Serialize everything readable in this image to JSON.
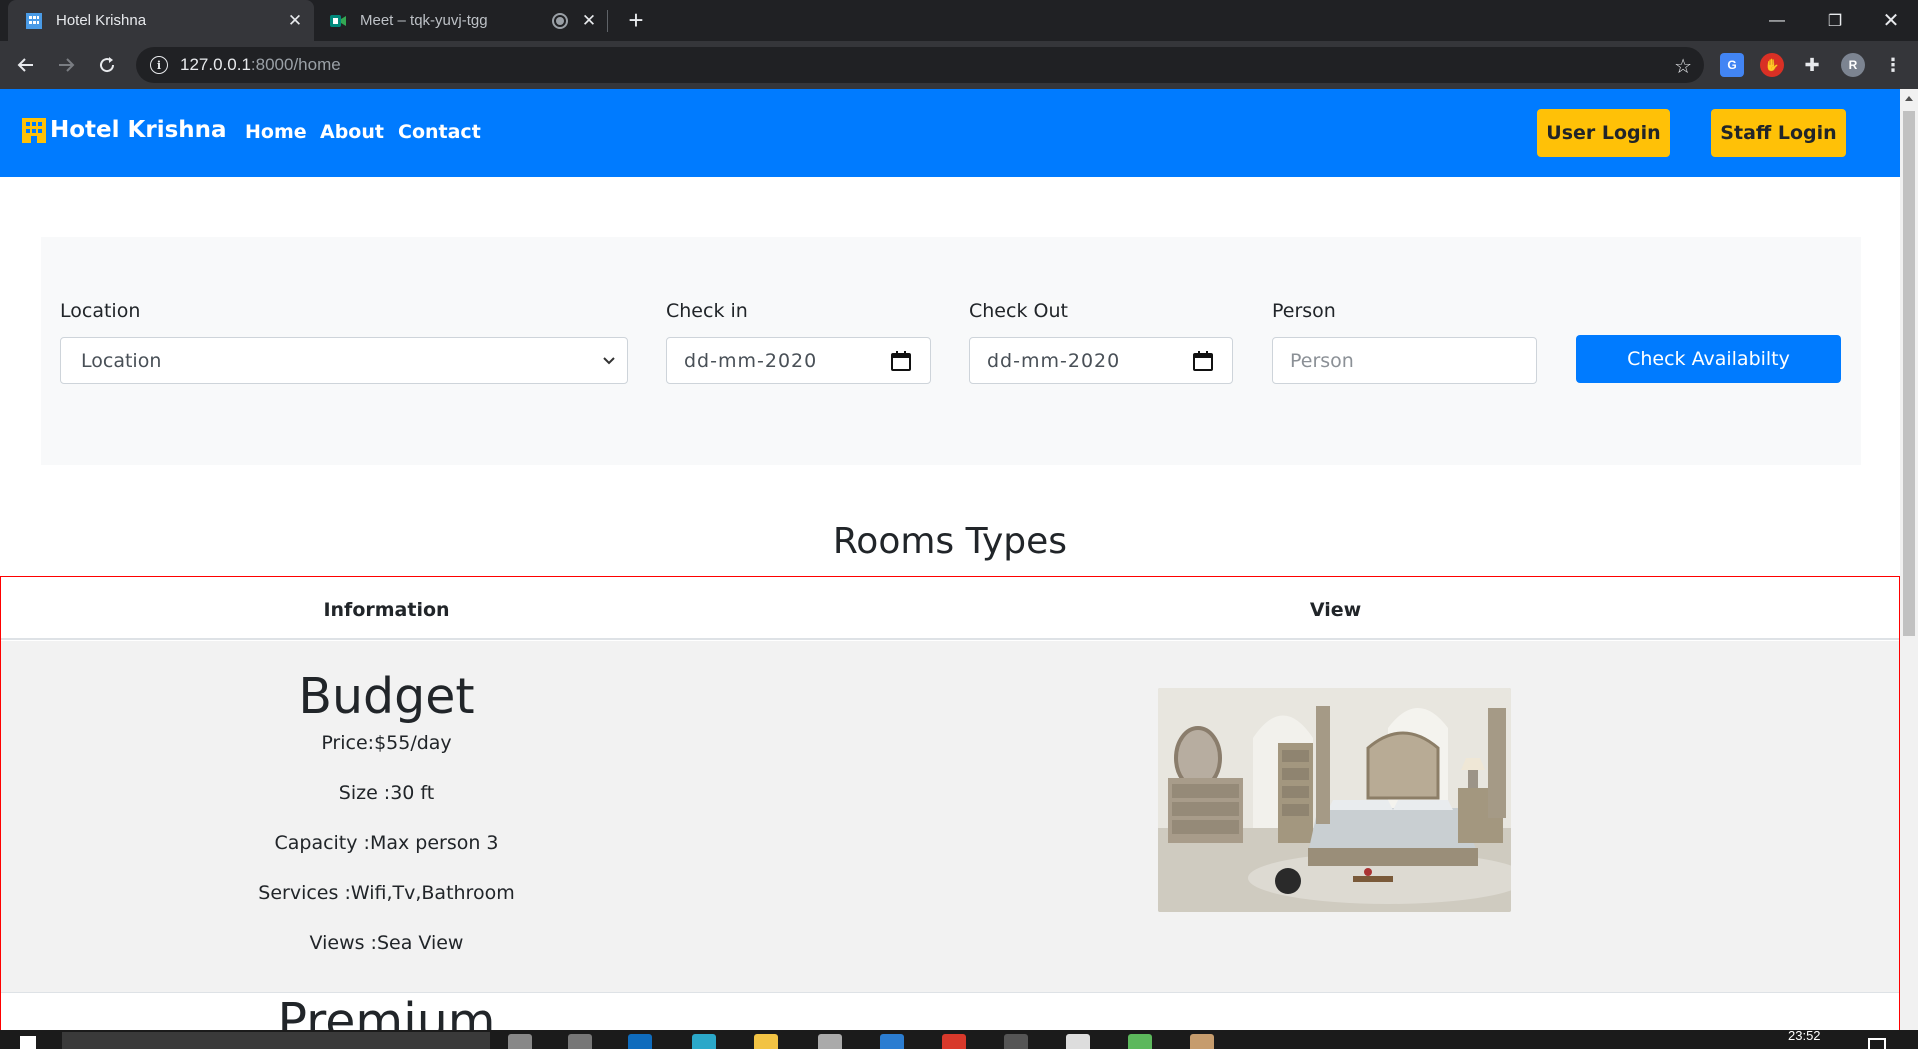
{
  "browser": {
    "tabs": [
      {
        "title": "Hotel Krishna",
        "active": true
      },
      {
        "title": "Meet – tqk-yuvj-tgg",
        "active": false
      }
    ],
    "url_host": "127.0.0.1",
    "url_path": ":8000/home",
    "profile_initial": "R"
  },
  "navbar": {
    "brand": "Hotel Krishna",
    "links": [
      "Home",
      "About",
      "Contact"
    ],
    "user_login": "User Login",
    "staff_login": "Staff Login"
  },
  "search": {
    "location_label": "Location",
    "location_value": "Location",
    "checkin_label": "Check in",
    "checkin_value": "dd-mm-2020",
    "checkout_label": "Check Out",
    "checkout_value": "dd-mm-2020",
    "person_label": "Person",
    "person_placeholder": "Person",
    "button": "Check Availabilty"
  },
  "rooms": {
    "title": "Rooms Types",
    "headers": [
      "Information",
      "View"
    ],
    "items": [
      {
        "name": "Budget",
        "price": "Price:$55/day",
        "size": "Size :30 ft",
        "capacity": "Capacity :Max person 3",
        "services": "Services :Wifi,Tv,Bathroom",
        "views": "Views :Sea View"
      },
      {
        "name": "Premium"
      }
    ]
  },
  "taskbar": {
    "time": "23:52"
  },
  "colors": {
    "primary": "#007bff",
    "warning": "#ffc107",
    "panel": "#f8f9fa",
    "row": "#f2f2f2",
    "table_border": "#ff0000"
  }
}
